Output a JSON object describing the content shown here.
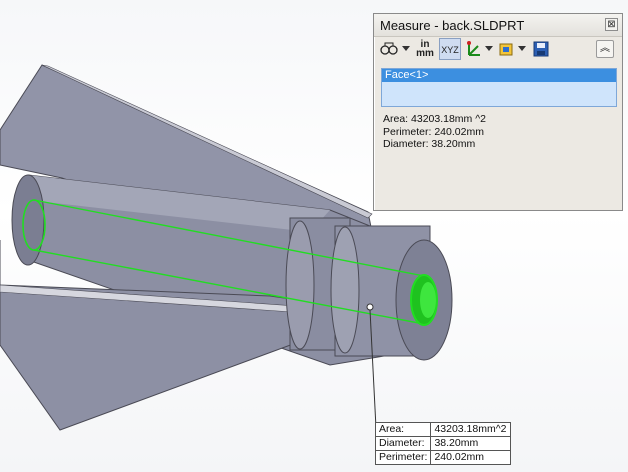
{
  "dialog": {
    "title": "Measure - back.SLDPRT",
    "close_glyph": "⊠",
    "toolbar": {
      "arc_circle_icon": "arc-circle-measure-icon",
      "units_label_top": "in",
      "units_label_bottom": "mm",
      "xyz_label": "XYZ",
      "xyz_pressed": true,
      "point_to_point_icon": "point-to-point-icon",
      "projection_icon": "projection-icon",
      "save_icon": "save-icon",
      "collapse_icon": "collapse-up-icon"
    },
    "selection": [
      "Face<1>"
    ],
    "results": {
      "area": "Area: 43203.18mm ^2",
      "perimeter": "Perimeter: 240.02mm",
      "diameter": "Diameter: 38.20mm"
    }
  },
  "callout": {
    "rows": [
      {
        "label": "Area:",
        "value": "43203.18mm^2"
      },
      {
        "label": "Diameter:",
        "value": "38.20mm"
      },
      {
        "label": "Perimeter:",
        "value": "240.02mm"
      }
    ]
  },
  "colors": {
    "part_face": "#8f92a6",
    "part_dark": "#6e7185",
    "part_light": "#b5b7c6",
    "highlight": "#22dd22",
    "selection": "#3c8fe0"
  }
}
